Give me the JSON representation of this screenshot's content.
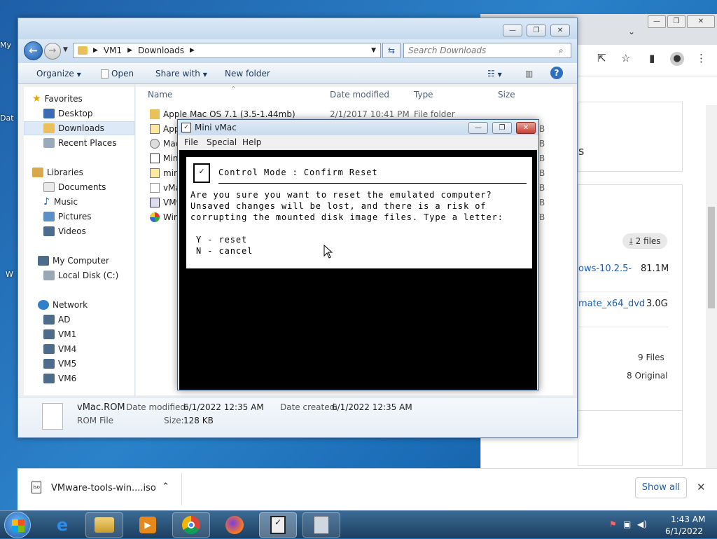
{
  "desktop": {
    "icon_labels": [
      "My",
      "Dat",
      "W"
    ]
  },
  "chrome": {
    "files_badge": "2 files",
    "rows": [
      {
        "name": "ows-10.2.5-",
        "size": "81.1M"
      },
      {
        "name": "mate_x64_dvd",
        "size": "3.0G"
      }
    ],
    "summary_files": "9 Files",
    "summary_original": "8 Original",
    "s_char": "s"
  },
  "explorer": {
    "breadcrumb": [
      "VM1",
      "Downloads"
    ],
    "search_placeholder": "Search Downloads",
    "toolbar": {
      "organize": "Organize",
      "open": "Open",
      "share_with": "Share with",
      "new_folder": "New folder"
    },
    "nav": {
      "favorites": "Favorites",
      "desktop": "Desktop",
      "downloads": "Downloads",
      "recent": "Recent Places",
      "libraries": "Libraries",
      "documents": "Documents",
      "music": "Music",
      "pictures": "Pictures",
      "videos": "Videos",
      "computer": "My Computer",
      "local_disk": "Local Disk (C:)",
      "network": "Network",
      "ad": "AD",
      "vm1": "VM1",
      "vm4": "VM4",
      "vm5": "VM5",
      "vm6": "VM6"
    },
    "columns": {
      "name": "Name",
      "date": "Date modified",
      "type": "Type",
      "size": "Size"
    },
    "files": [
      {
        "name": "Apple Mac OS 7.1 (3.5-1.44mb)",
        "date": "2/1/2017 10:41 PM",
        "type": "File folder",
        "size": ""
      },
      {
        "name": "App",
        "date": "",
        "type": "",
        "size": "B"
      },
      {
        "name": "Mac",
        "date": "",
        "type": "",
        "size": "B"
      },
      {
        "name": "Min",
        "date": "",
        "type": "",
        "size": "B"
      },
      {
        "name": "min",
        "date": "",
        "type": "",
        "size": "B"
      },
      {
        "name": "vMa",
        "date": "",
        "type": "",
        "size": "B"
      },
      {
        "name": "VMw",
        "date": "",
        "type": "",
        "size": "B"
      },
      {
        "name": "Win",
        "date": "",
        "type": "",
        "size": "B"
      }
    ],
    "details": {
      "filename": "vMac.ROM",
      "filetype": "ROM File",
      "date_modified_label": "Date modified:",
      "date_modified": "6/1/2022 12:35 AM",
      "date_created_label": "Date created:",
      "date_created": "6/1/2022 12:35 AM",
      "size_label": "Size:",
      "size": "128 KB"
    }
  },
  "vmac": {
    "title": "Mini vMac",
    "menu": [
      "File",
      "Special",
      "Help"
    ],
    "dialog_title": "Control Mode : Confirm Reset",
    "message": "Are you sure you want to reset the emulated computer?\nUnsaved changes will be lost, and there is a risk of\ncorrupting the mounted disk image files. Type a letter:",
    "options": "Y - reset\nN - cancel"
  },
  "download_bar": {
    "file": "VMware-tools-win....iso",
    "show_all": "Show all"
  },
  "taskbar": {
    "time": "1:43 AM",
    "date": "6/1/2022"
  }
}
